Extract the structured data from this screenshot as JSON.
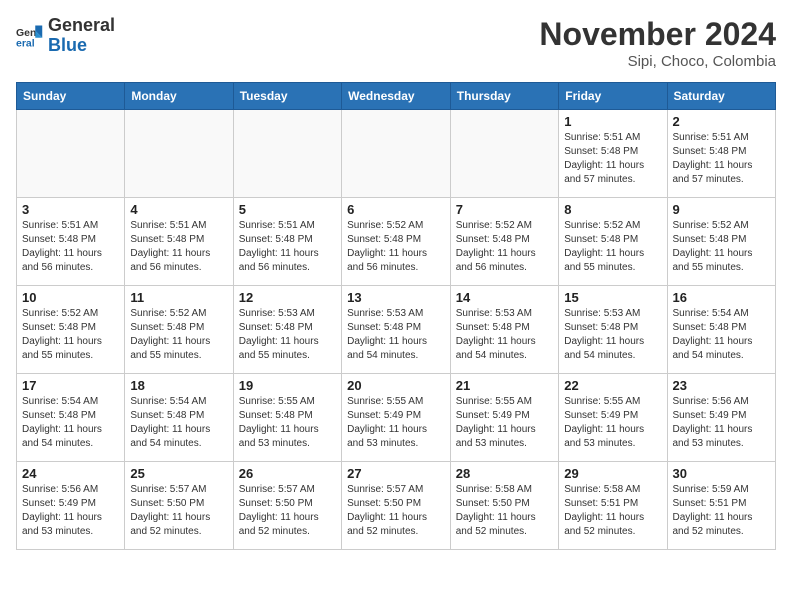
{
  "header": {
    "logo_general": "General",
    "logo_blue": "Blue",
    "month_year": "November 2024",
    "location": "Sipi, Choco, Colombia"
  },
  "weekdays": [
    "Sunday",
    "Monday",
    "Tuesday",
    "Wednesday",
    "Thursday",
    "Friday",
    "Saturday"
  ],
  "weeks": [
    [
      {
        "day": "",
        "info": ""
      },
      {
        "day": "",
        "info": ""
      },
      {
        "day": "",
        "info": ""
      },
      {
        "day": "",
        "info": ""
      },
      {
        "day": "",
        "info": ""
      },
      {
        "day": "1",
        "info": "Sunrise: 5:51 AM\nSunset: 5:48 PM\nDaylight: 11 hours\nand 57 minutes."
      },
      {
        "day": "2",
        "info": "Sunrise: 5:51 AM\nSunset: 5:48 PM\nDaylight: 11 hours\nand 57 minutes."
      }
    ],
    [
      {
        "day": "3",
        "info": "Sunrise: 5:51 AM\nSunset: 5:48 PM\nDaylight: 11 hours\nand 56 minutes."
      },
      {
        "day": "4",
        "info": "Sunrise: 5:51 AM\nSunset: 5:48 PM\nDaylight: 11 hours\nand 56 minutes."
      },
      {
        "day": "5",
        "info": "Sunrise: 5:51 AM\nSunset: 5:48 PM\nDaylight: 11 hours\nand 56 minutes."
      },
      {
        "day": "6",
        "info": "Sunrise: 5:52 AM\nSunset: 5:48 PM\nDaylight: 11 hours\nand 56 minutes."
      },
      {
        "day": "7",
        "info": "Sunrise: 5:52 AM\nSunset: 5:48 PM\nDaylight: 11 hours\nand 56 minutes."
      },
      {
        "day": "8",
        "info": "Sunrise: 5:52 AM\nSunset: 5:48 PM\nDaylight: 11 hours\nand 55 minutes."
      },
      {
        "day": "9",
        "info": "Sunrise: 5:52 AM\nSunset: 5:48 PM\nDaylight: 11 hours\nand 55 minutes."
      }
    ],
    [
      {
        "day": "10",
        "info": "Sunrise: 5:52 AM\nSunset: 5:48 PM\nDaylight: 11 hours\nand 55 minutes."
      },
      {
        "day": "11",
        "info": "Sunrise: 5:52 AM\nSunset: 5:48 PM\nDaylight: 11 hours\nand 55 minutes."
      },
      {
        "day": "12",
        "info": "Sunrise: 5:53 AM\nSunset: 5:48 PM\nDaylight: 11 hours\nand 55 minutes."
      },
      {
        "day": "13",
        "info": "Sunrise: 5:53 AM\nSunset: 5:48 PM\nDaylight: 11 hours\nand 54 minutes."
      },
      {
        "day": "14",
        "info": "Sunrise: 5:53 AM\nSunset: 5:48 PM\nDaylight: 11 hours\nand 54 minutes."
      },
      {
        "day": "15",
        "info": "Sunrise: 5:53 AM\nSunset: 5:48 PM\nDaylight: 11 hours\nand 54 minutes."
      },
      {
        "day": "16",
        "info": "Sunrise: 5:54 AM\nSunset: 5:48 PM\nDaylight: 11 hours\nand 54 minutes."
      }
    ],
    [
      {
        "day": "17",
        "info": "Sunrise: 5:54 AM\nSunset: 5:48 PM\nDaylight: 11 hours\nand 54 minutes."
      },
      {
        "day": "18",
        "info": "Sunrise: 5:54 AM\nSunset: 5:48 PM\nDaylight: 11 hours\nand 54 minutes."
      },
      {
        "day": "19",
        "info": "Sunrise: 5:55 AM\nSunset: 5:48 PM\nDaylight: 11 hours\nand 53 minutes."
      },
      {
        "day": "20",
        "info": "Sunrise: 5:55 AM\nSunset: 5:49 PM\nDaylight: 11 hours\nand 53 minutes."
      },
      {
        "day": "21",
        "info": "Sunrise: 5:55 AM\nSunset: 5:49 PM\nDaylight: 11 hours\nand 53 minutes."
      },
      {
        "day": "22",
        "info": "Sunrise: 5:55 AM\nSunset: 5:49 PM\nDaylight: 11 hours\nand 53 minutes."
      },
      {
        "day": "23",
        "info": "Sunrise: 5:56 AM\nSunset: 5:49 PM\nDaylight: 11 hours\nand 53 minutes."
      }
    ],
    [
      {
        "day": "24",
        "info": "Sunrise: 5:56 AM\nSunset: 5:49 PM\nDaylight: 11 hours\nand 53 minutes."
      },
      {
        "day": "25",
        "info": "Sunrise: 5:57 AM\nSunset: 5:50 PM\nDaylight: 11 hours\nand 52 minutes."
      },
      {
        "day": "26",
        "info": "Sunrise: 5:57 AM\nSunset: 5:50 PM\nDaylight: 11 hours\nand 52 minutes."
      },
      {
        "day": "27",
        "info": "Sunrise: 5:57 AM\nSunset: 5:50 PM\nDaylight: 11 hours\nand 52 minutes."
      },
      {
        "day": "28",
        "info": "Sunrise: 5:58 AM\nSunset: 5:50 PM\nDaylight: 11 hours\nand 52 minutes."
      },
      {
        "day": "29",
        "info": "Sunrise: 5:58 AM\nSunset: 5:51 PM\nDaylight: 11 hours\nand 52 minutes."
      },
      {
        "day": "30",
        "info": "Sunrise: 5:59 AM\nSunset: 5:51 PM\nDaylight: 11 hours\nand 52 minutes."
      }
    ]
  ]
}
